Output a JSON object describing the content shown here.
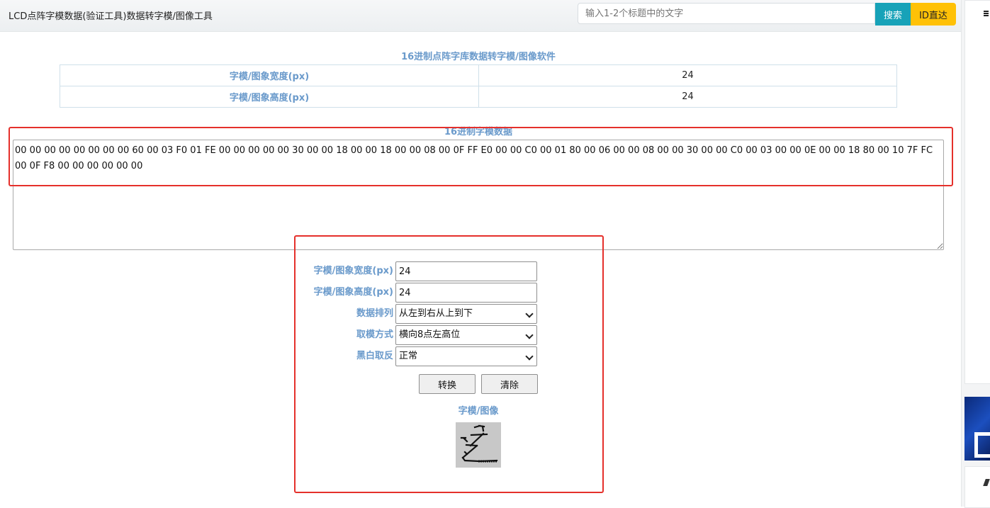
{
  "header": {
    "site_title": "LCD点阵字模数据(验证工具)数据转字模/图像工具",
    "search_placeholder": "输入1-2个标题中的文字",
    "search_button": "搜索",
    "id_button": "ID直达"
  },
  "info_table": {
    "caption": "16进制点阵字库数据转字模/图像软件",
    "rows": [
      {
        "label": "字模/图象宽度(px)",
        "value": "24"
      },
      {
        "label": "字模/图象高度(px)",
        "value": "24"
      }
    ]
  },
  "hex_section": {
    "label": "16进制字模数据",
    "data": "00 00 00 00 00 00 00 00 60 00 03 F0 01 FE 00 00 00 00 00 30 00 00 18 00 00 18 00 00 08 00 0F FF E0 00 00 C0 00 01 80 00 06 00 00 08 00 00 30 00 00 C0 00 03 00 00 0E 00 00 18 80 00 10 7F FC 00 0F F8 00 00 00 00 00 00"
  },
  "form": {
    "width_label": "字模/图象宽度(px)",
    "width_value": "24",
    "height_label": "字模/图象高度(px)",
    "height_value": "24",
    "order_label": "数据排列",
    "order_value": "从左到右从上到下",
    "mode_label": "取模方式",
    "mode_value": "横向8点左高位",
    "invert_label": "黑白取反",
    "invert_value": "正常",
    "convert_button": "转换",
    "clear_button": "清除",
    "preview_label": "字模/图像"
  },
  "colors": {
    "accent_label": "#6a9acb",
    "search_button": "#17a2b8",
    "id_button": "#ffc107",
    "highlight_box": "#e5302b"
  }
}
